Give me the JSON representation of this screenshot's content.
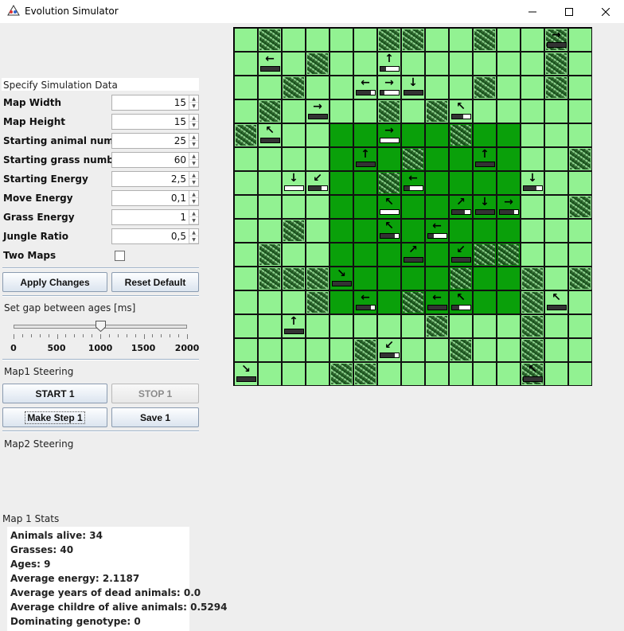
{
  "window": {
    "title": "Evolution Simulator",
    "minimize": "—",
    "maximize": "☐",
    "close": "✕"
  },
  "sim": {
    "header": "Specify Simulation Data",
    "fields": [
      {
        "label": "Map Width",
        "value": "15"
      },
      {
        "label": "Map Height",
        "value": "15"
      },
      {
        "label": "Starting animal number",
        "value": "25"
      },
      {
        "label": "Starting grass number",
        "value": "60"
      },
      {
        "label": "Starting Energy",
        "value": "2,5"
      },
      {
        "label": "Move Energy",
        "value": "0,1"
      },
      {
        "label": "Grass Energy",
        "value": "1"
      },
      {
        "label": "Jungle Ratio",
        "value": "0,5"
      }
    ],
    "two_maps_label": "Two Maps",
    "two_maps_checked": false,
    "apply_label": "Apply Changes",
    "reset_label": "Reset Default"
  },
  "gap": {
    "label": "Set gap between ages [ms]",
    "value": 1000,
    "min": 0,
    "max": 2000,
    "tick_labels": [
      "0",
      "500",
      "1000",
      "1500",
      "2000"
    ]
  },
  "map1": {
    "label": "Map1 Steering",
    "start_label": "START 1",
    "stop_label": "STOP 1",
    "step_label": "Make Step 1",
    "save_label": "Save 1"
  },
  "map2": {
    "label": "Map2 Steering"
  },
  "stats": {
    "header": "Map 1 Stats",
    "lines": [
      "Animals alive: 34",
      "Grasses: 40",
      "Ages: 9",
      "Average energy: 2.1187",
      "Average years of dead animals: 0.0",
      "Average childre of alive animals: 0.5294",
      "Dominating genotype: 0"
    ]
  },
  "grid": {
    "size": 15,
    "colors": {
      "steppe": "#92f292",
      "jungle": "#0aa00a",
      "grid_line": "#111111"
    },
    "jungle": {
      "col_from": 4,
      "col_to": 11,
      "row_from": 4,
      "row_to": 11
    },
    "grass": [
      [
        0,
        1
      ],
      [
        0,
        6
      ],
      [
        0,
        7
      ],
      [
        0,
        10
      ],
      [
        0,
        13
      ],
      [
        1,
        3
      ],
      [
        1,
        13
      ],
      [
        2,
        2
      ],
      [
        2,
        10
      ],
      [
        2,
        13
      ],
      [
        3,
        1
      ],
      [
        3,
        6
      ],
      [
        3,
        8
      ],
      [
        4,
        0
      ],
      [
        4,
        9
      ],
      [
        5,
        7
      ],
      [
        5,
        14
      ],
      [
        6,
        6
      ],
      [
        7,
        14
      ],
      [
        8,
        2
      ],
      [
        9,
        1
      ],
      [
        9,
        10
      ],
      [
        9,
        11
      ],
      [
        10,
        1
      ],
      [
        10,
        2
      ],
      [
        10,
        3
      ],
      [
        10,
        9
      ],
      [
        10,
        12
      ],
      [
        10,
        14
      ],
      [
        11,
        3
      ],
      [
        11,
        7
      ],
      [
        11,
        12
      ],
      [
        12,
        8
      ],
      [
        12,
        12
      ],
      [
        13,
        5
      ],
      [
        13,
        9
      ],
      [
        13,
        12
      ],
      [
        14,
        4
      ],
      [
        14,
        5
      ],
      [
        14,
        12
      ]
    ],
    "animals": [
      {
        "r": 0,
        "c": 13,
        "dir": "→",
        "energy": 1.0
      },
      {
        "r": 1,
        "c": 1,
        "dir": "←",
        "energy": 1.0
      },
      {
        "r": 1,
        "c": 6,
        "dir": "↑",
        "energy": 0.3
      },
      {
        "r": 2,
        "c": 5,
        "dir": "←",
        "energy": 0.8
      },
      {
        "r": 2,
        "c": 6,
        "dir": "→",
        "energy": 0.2
      },
      {
        "r": 2,
        "c": 7,
        "dir": "↓",
        "energy": 1.0
      },
      {
        "r": 3,
        "c": 3,
        "dir": "→",
        "energy": 1.0
      },
      {
        "r": 3,
        "c": 9,
        "dir": "↖",
        "energy": 0.6
      },
      {
        "r": 4,
        "c": 1,
        "dir": "↖",
        "energy": 1.0
      },
      {
        "r": 4,
        "c": 6,
        "dir": "→",
        "energy": 0.0
      },
      {
        "r": 5,
        "c": 5,
        "dir": "↑",
        "energy": 1.0
      },
      {
        "r": 5,
        "c": 10,
        "dir": "↑",
        "energy": 1.0
      },
      {
        "r": 6,
        "c": 2,
        "dir": "↓",
        "energy": 0.0
      },
      {
        "r": 6,
        "c": 3,
        "dir": "↙",
        "energy": 0.7
      },
      {
        "r": 6,
        "c": 7,
        "dir": "←",
        "energy": 0.3
      },
      {
        "r": 6,
        "c": 12,
        "dir": "↓",
        "energy": 0.7
      },
      {
        "r": 7,
        "c": 6,
        "dir": "↖",
        "energy": 0.0
      },
      {
        "r": 7,
        "c": 9,
        "dir": "↗",
        "energy": 0.7
      },
      {
        "r": 7,
        "c": 10,
        "dir": "↓",
        "energy": 1.0
      },
      {
        "r": 7,
        "c": 11,
        "dir": "→",
        "energy": 0.8
      },
      {
        "r": 8,
        "c": 6,
        "dir": "↖",
        "energy": 0.8
      },
      {
        "r": 8,
        "c": 8,
        "dir": "←",
        "energy": 0.3
      },
      {
        "r": 9,
        "c": 7,
        "dir": "↗",
        "energy": 1.0
      },
      {
        "r": 9,
        "c": 9,
        "dir": "↙",
        "energy": 1.0
      },
      {
        "r": 10,
        "c": 4,
        "dir": "↘",
        "energy": 1.0
      },
      {
        "r": 11,
        "c": 5,
        "dir": "←",
        "energy": 0.8
      },
      {
        "r": 11,
        "c": 8,
        "dir": "←",
        "energy": 1.0
      },
      {
        "r": 11,
        "c": 9,
        "dir": "↖",
        "energy": 0.4
      },
      {
        "r": 11,
        "c": 13,
        "dir": "↖",
        "energy": 1.0
      },
      {
        "r": 12,
        "c": 2,
        "dir": "↑",
        "energy": 1.0
      },
      {
        "r": 13,
        "c": 6,
        "dir": "↙",
        "energy": 0.8
      },
      {
        "r": 14,
        "c": 0,
        "dir": "↘",
        "energy": 1.0
      },
      {
        "r": 14,
        "c": 12,
        "dir": "↖",
        "energy": 1.0
      }
    ]
  }
}
